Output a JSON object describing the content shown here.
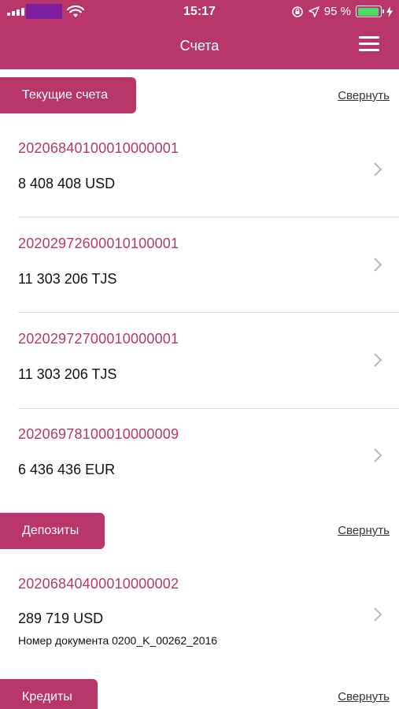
{
  "status_bar": {
    "time": "15:17",
    "battery_percent": "95 %",
    "battery_level": 0.95
  },
  "header": {
    "title": "Счета"
  },
  "sections": [
    {
      "label": "Текущие счета",
      "collapse_label": "Свернуть",
      "accounts": [
        {
          "number": "20206840100010000001",
          "balance": "8 408 408 USD"
        },
        {
          "number": "20202972600010100001",
          "balance": "11 303 206 TJS"
        },
        {
          "number": "20202972700010000001",
          "balance": "11 303 206 TJS"
        },
        {
          "number": "20206978100010000009",
          "balance": "6 436 436 EUR"
        }
      ]
    },
    {
      "label": "Депозиты",
      "collapse_label": "Свернуть",
      "accounts": [
        {
          "number": "20206840400010000002",
          "balance": "289 719 USD",
          "document": "Номер документа 0200_K_00262_2016"
        }
      ]
    },
    {
      "label": "Кредиты",
      "collapse_label": "Свернуть",
      "accounts": []
    }
  ],
  "colors": {
    "brand": "#b83669",
    "battery": "#4cd964"
  }
}
